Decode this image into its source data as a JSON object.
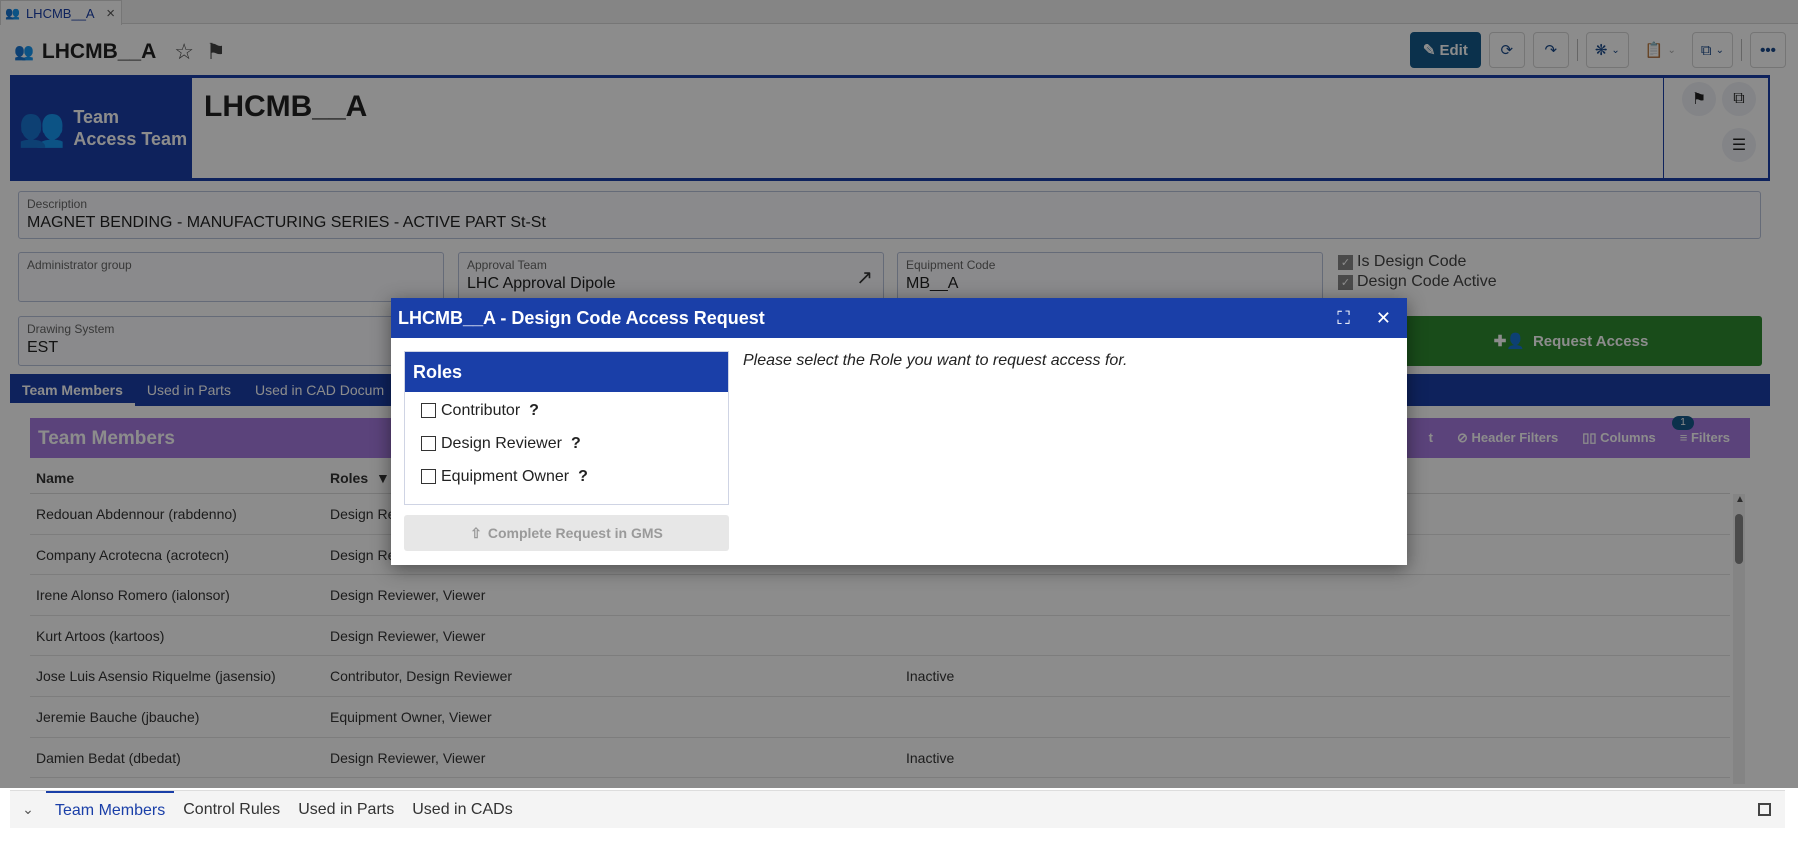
{
  "doc_tab": {
    "label": "LHCMB__A",
    "close": "×"
  },
  "page": {
    "title": "LHCMB__A"
  },
  "toolbar": {
    "edit_label": "Edit"
  },
  "header": {
    "type_line1": "Team",
    "type_line2": "Access Team",
    "name": "LHCMB__A"
  },
  "fields": {
    "description": {
      "label": "Description",
      "value": "MAGNET BENDING - MANUFACTURING SERIES - ACTIVE PART St-St"
    },
    "admin_group": {
      "label": "Administrator group",
      "value": ""
    },
    "approval_team": {
      "label": "Approval Team",
      "value": "LHC Approval Dipole"
    },
    "equipment_code": {
      "label": "Equipment Code",
      "value": "MB__A"
    },
    "drawing_system": {
      "label": "Drawing System",
      "value": "EST"
    },
    "is_design_code": "Is Design Code",
    "design_code_active": "Design Code Active"
  },
  "request_access_label": "Request Access",
  "tabs": [
    {
      "label": "Team Members"
    },
    {
      "label": "Used in Parts"
    },
    {
      "label": "Used in CAD Docum"
    }
  ],
  "team_members": {
    "title": "Team Members",
    "tools": [
      "t",
      "Header Filters",
      "Columns",
      "Filters"
    ],
    "filter_count": "1",
    "columns": [
      "Name",
      "Roles"
    ],
    "rows": [
      {
        "name": "Redouan Abdennour (rabdenno)",
        "roles": "Design Re",
        "status": ""
      },
      {
        "name": "Company Acrotecna (acrotecn)",
        "roles": "Design Re",
        "status": ""
      },
      {
        "name": "Irene Alonso Romero (ialonsor)",
        "roles": "Design Reviewer, Viewer",
        "status": ""
      },
      {
        "name": "Kurt Artoos (kartoos)",
        "roles": "Design Reviewer, Viewer",
        "status": ""
      },
      {
        "name": "Jose Luis Asensio Riquelme (jasensio)",
        "roles": "Contributor, Design Reviewer",
        "status": "Inactive"
      },
      {
        "name": "Jeremie Bauche (jbauche)",
        "roles": "Equipment Owner, Viewer",
        "status": ""
      },
      {
        "name": "Damien Bedat (dbedat)",
        "roles": "Design Reviewer, Viewer",
        "status": "Inactive"
      }
    ]
  },
  "bottom_tabs": [
    "Team Members",
    "Control Rules",
    "Used in Parts",
    "Used in CADs"
  ],
  "modal": {
    "title": "LHCMB__A - Design Code Access Request",
    "roles_title": "Roles",
    "roles": [
      "Contributor",
      "Design Reviewer",
      "Equipment Owner"
    ],
    "instruction": "Please select the Role you want to request access for.",
    "complete_label": "Complete Request in GMS"
  },
  "colors": {
    "primary": "#1a3fa8",
    "success": "#2e8b30",
    "accent_panel": "#a77be0"
  }
}
